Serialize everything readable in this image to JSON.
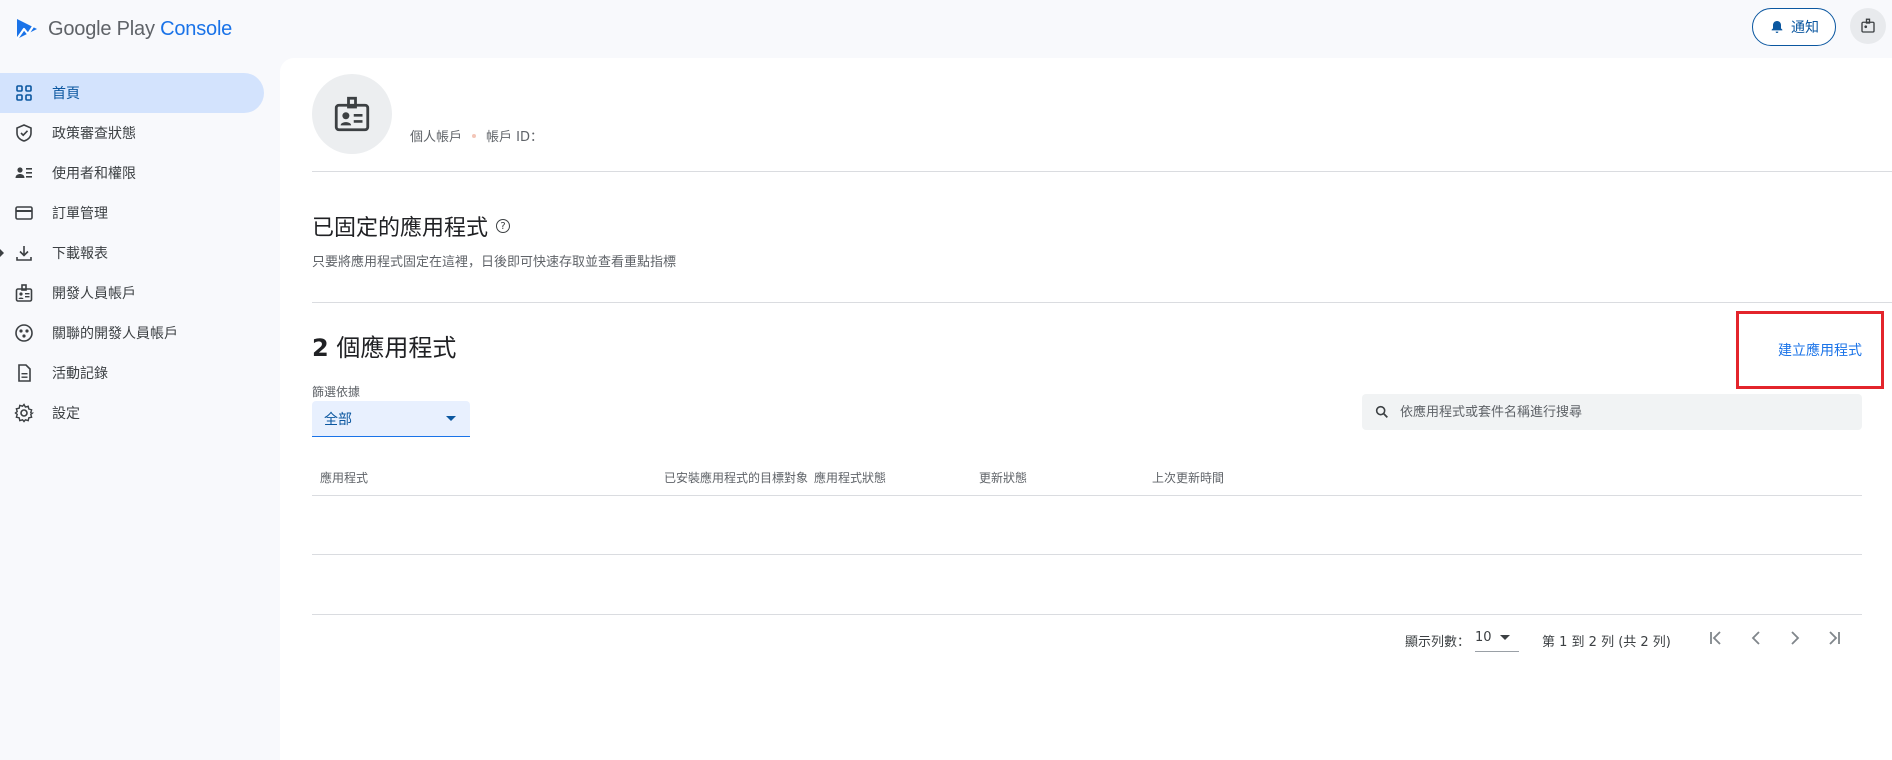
{
  "brand": {
    "google_play": "Google Play",
    "console": "Console"
  },
  "header": {
    "notify_label": "通知"
  },
  "sidebar": {
    "items": [
      {
        "label": "首頁",
        "icon": "grid-icon"
      },
      {
        "label": "政策審查狀態",
        "icon": "shield-check-icon"
      },
      {
        "label": "使用者和權限",
        "icon": "users-list-icon"
      },
      {
        "label": "訂單管理",
        "icon": "credit-card-icon"
      },
      {
        "label": "下載報表",
        "icon": "download-icon"
      },
      {
        "label": "開發人員帳戶",
        "icon": "badge-icon"
      },
      {
        "label": "關聯的開發人員帳戶",
        "icon": "linked-accounts-icon"
      },
      {
        "label": "活動記錄",
        "icon": "document-icon"
      },
      {
        "label": "設定",
        "icon": "gear-icon"
      }
    ]
  },
  "account": {
    "type": "個人帳戶",
    "id_label": "帳戶 ID："
  },
  "pinned": {
    "title": "已固定的應用程式",
    "help": "?",
    "description": "只要將應用程式固定在這裡，日後即可快速存取並查看重點指標"
  },
  "apps": {
    "count": "2",
    "count_suffix": " 個應用程式",
    "create_label": "建立應用程式",
    "filter_label": "篩選依據",
    "filter_value": "全部",
    "search_placeholder": "依應用程式或套件名稱進行搜尋",
    "columns": [
      "應用程式",
      "已安裝應用程式的目標對象",
      "應用程式狀態",
      "更新狀態",
      "上次更新時間"
    ]
  },
  "pagination": {
    "rows_label": "顯示列數：",
    "rows_value": "10",
    "range_text": "第 1 到 2 列 (共 2 列)"
  },
  "colors": {
    "accent": "#1a73e8",
    "active_nav_bg": "#d3e3fd",
    "highlight": "#e3242b"
  }
}
